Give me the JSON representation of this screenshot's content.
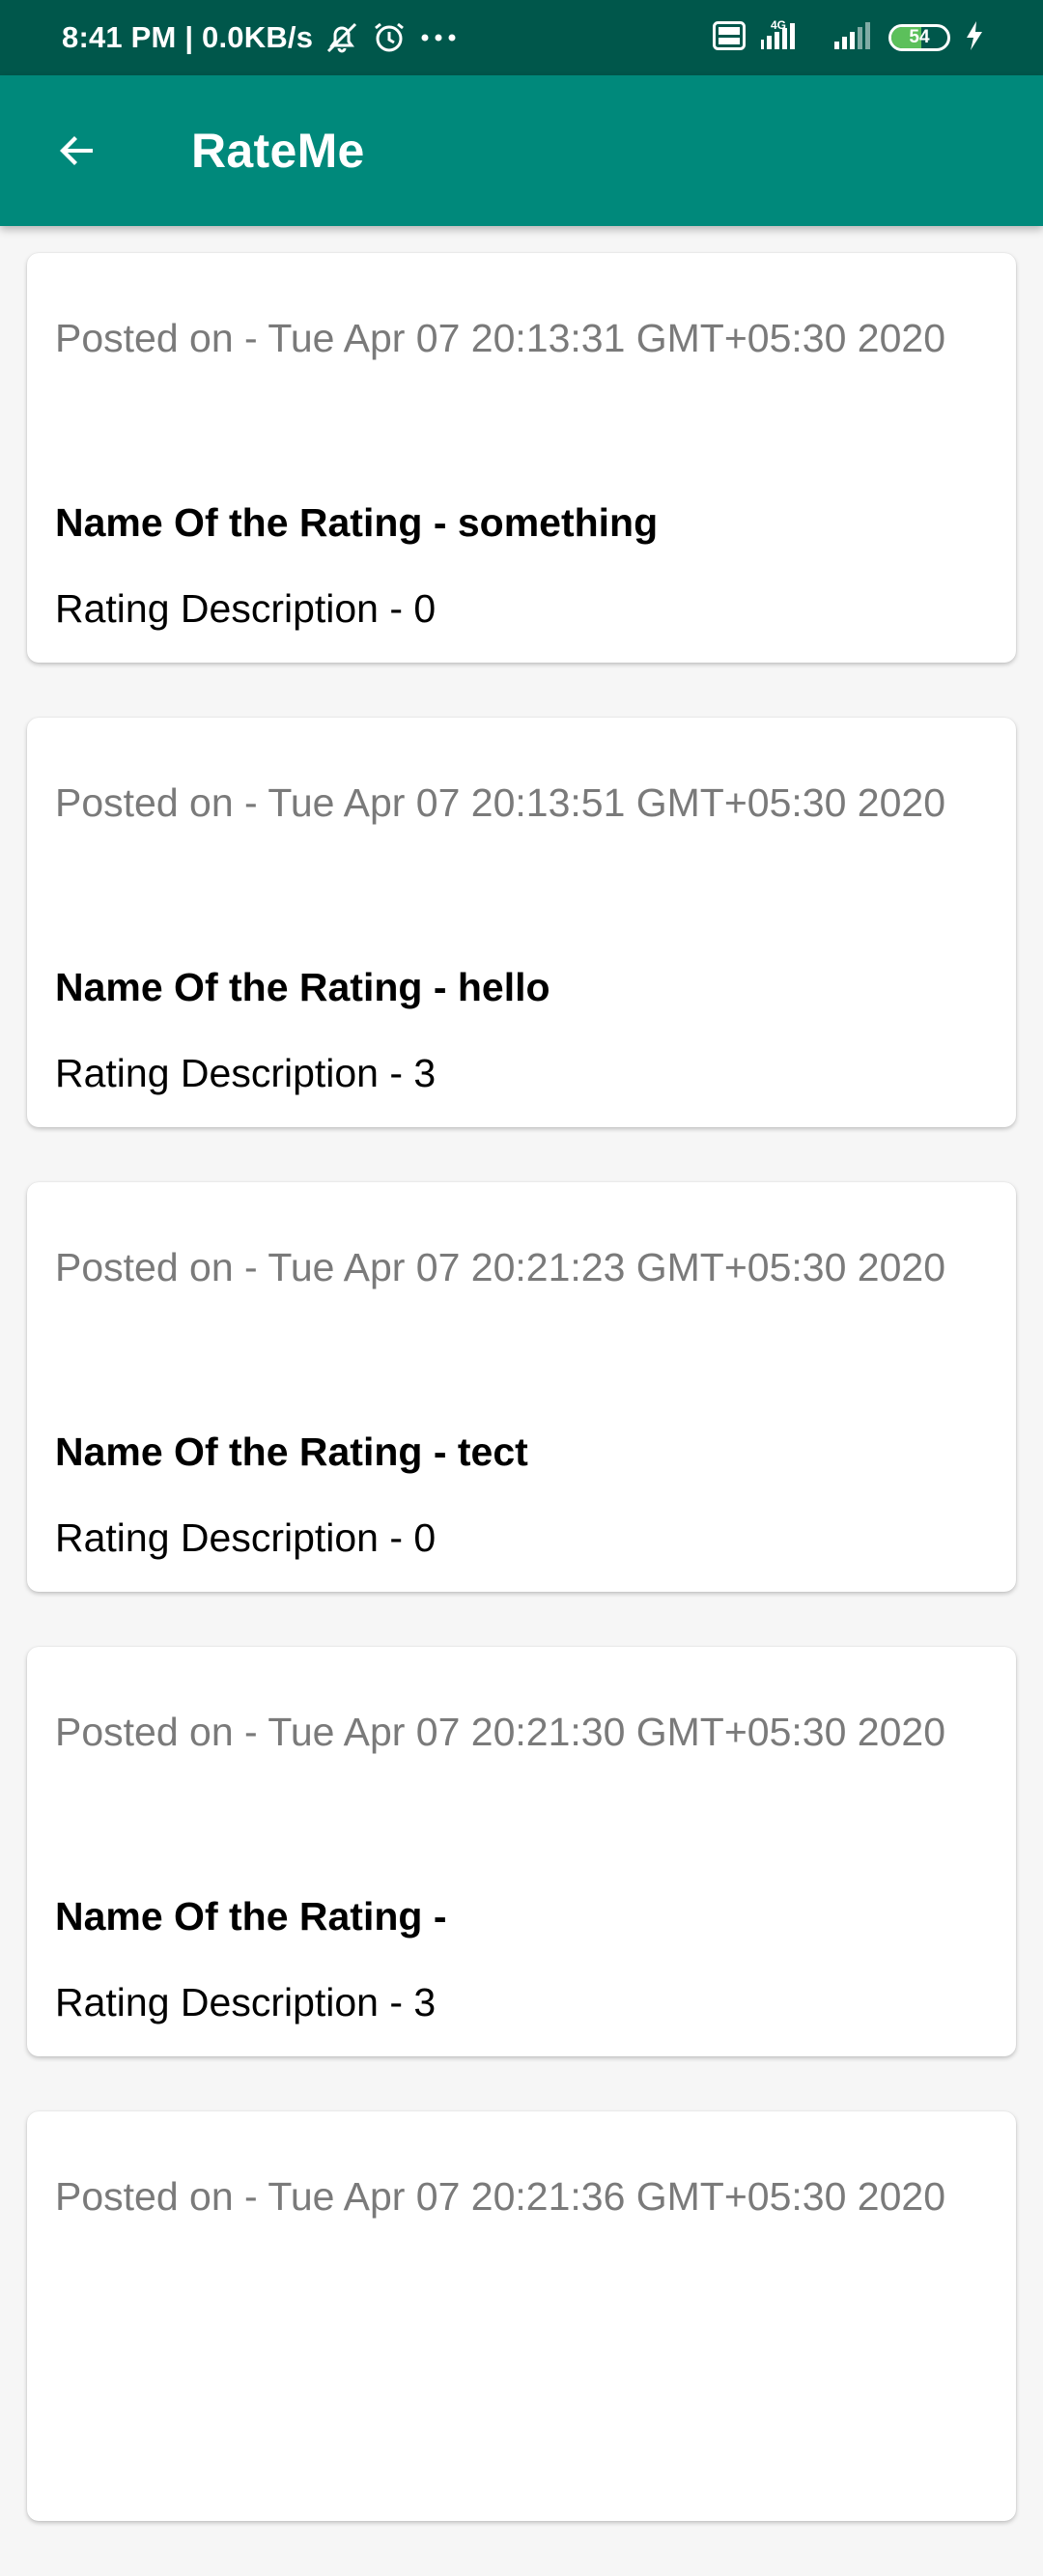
{
  "status_bar": {
    "time_info": "8:41 PM | 0.0KB/s",
    "battery_level": "54",
    "network": "4G"
  },
  "app_bar": {
    "title": "RateMe",
    "back_icon": "arrow-back-icon"
  },
  "ratings": [
    {
      "posted": "Posted on - Tue Apr 07 20:13:31 GMT+05:30 2020",
      "name": "Name Of the Rating - something",
      "description": "Rating Description - 0"
    },
    {
      "posted": "Posted on - Tue Apr 07 20:13:51 GMT+05:30 2020",
      "name": "Name Of the Rating - hello",
      "description": "Rating Description - 3"
    },
    {
      "posted": "Posted on - Tue Apr 07 20:21:23 GMT+05:30 2020",
      "name": "Name Of the Rating - tect",
      "description": "Rating Description - 0"
    },
    {
      "posted": "Posted on - Tue Apr 07 20:21:30 GMT+05:30 2020",
      "name": "Name Of the Rating -",
      "description": "Rating Description - 3"
    },
    {
      "posted": "Posted on - Tue Apr 07 20:21:36 GMT+05:30 2020"
    }
  ],
  "colors": {
    "status_bar": "#00574b",
    "app_bar": "#00897b",
    "battery_fill": "#5cc05b",
    "background": "#f6f6f6"
  }
}
